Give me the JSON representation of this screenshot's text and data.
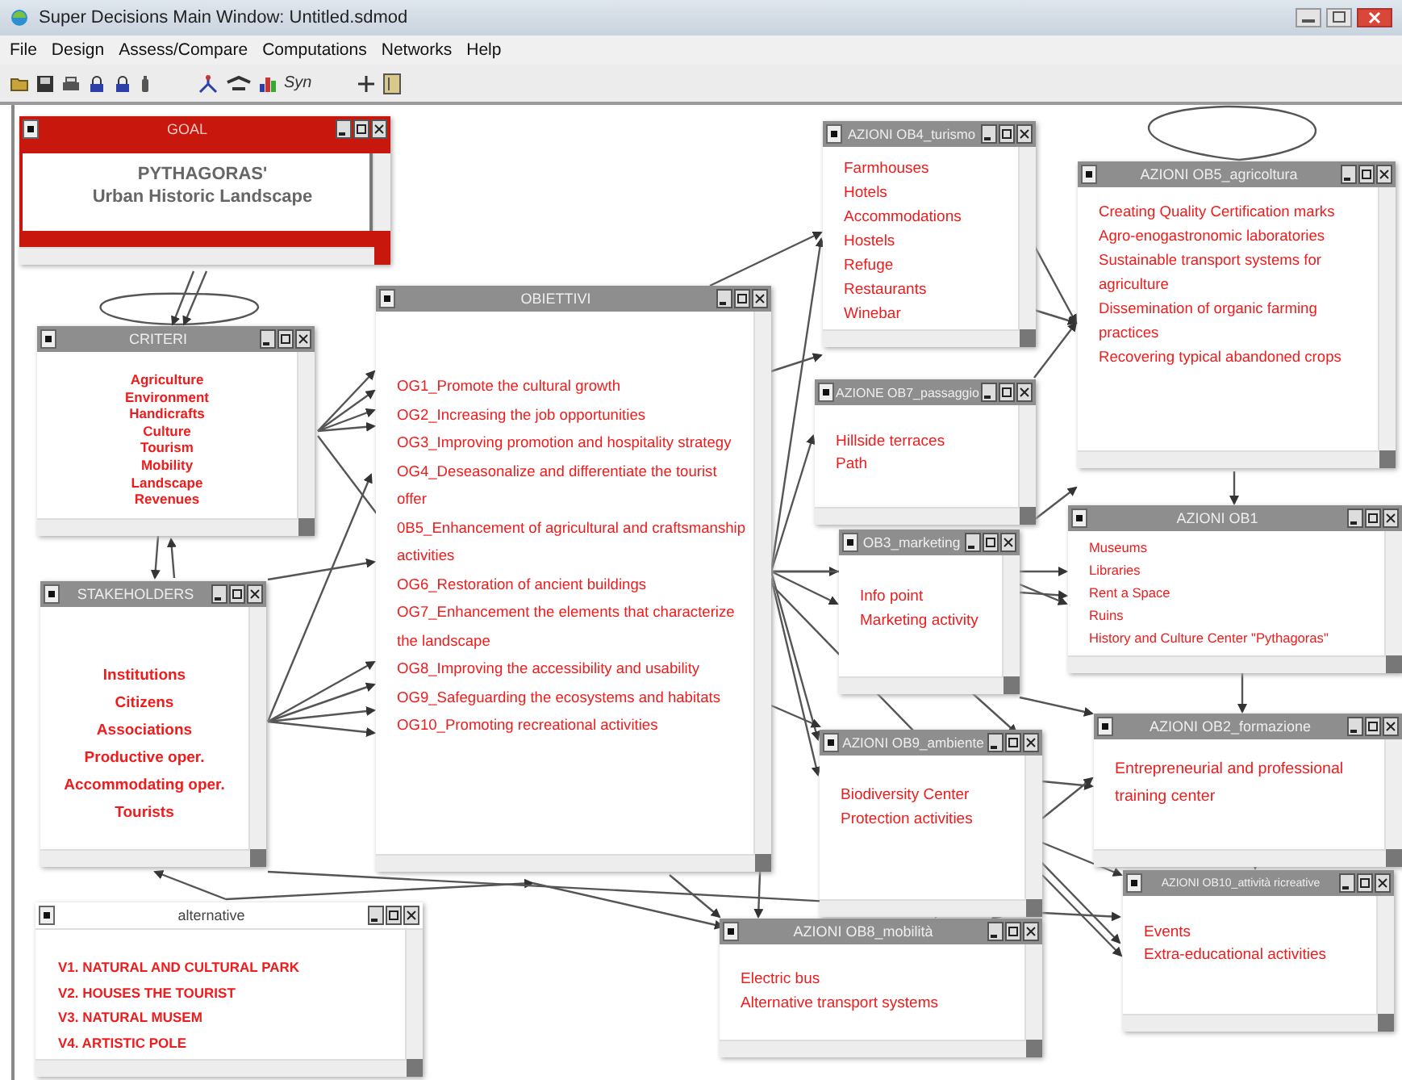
{
  "window": {
    "title": "Super Decisions Main Window: Untitled.sdmod"
  },
  "menu": [
    "File",
    "Design",
    "Assess/Compare",
    "Computations",
    "Networks",
    "Help"
  ],
  "toolbar": {
    "syn_label": "Syn"
  },
  "clusters": [
    {
      "kind": "goal",
      "title": "GOAL",
      "items": [
        "PYTHAGORAS'",
        "Urban Historic Landscape"
      ]
    },
    {
      "kind": "centered",
      "title": "CRITERI",
      "items": [
        "Agriculture",
        "Environment",
        "Handicrafts",
        "Culture",
        "Tourism",
        "Mobility",
        "Landscape",
        "Revenues"
      ]
    },
    {
      "kind": "list",
      "title": "OBIETTIVI",
      "items": [
        "OG1_Promote the cultural growth",
        "OG2_Increasing the job opportunities",
        "OG3_Improving promotion and hospitality strategy",
        "OG4_Deseasonalize and differentiate the tourist offer",
        "0B5_Enhancement of agricultural and craftsmanship activities",
        "OG6_Restoration of ancient buildings",
        "OG7_Enhancement the elements that characterize the landscape",
        "OG8_Improving the accessibility and usability",
        "OG9_Safeguarding the ecosystems and habitats",
        "OG10_Promoting recreational activities"
      ]
    },
    {
      "kind": "centered",
      "title": "STAKEHOLDERS",
      "items": [
        "Institutions",
        "Citizens",
        "Associations",
        "Productive oper.",
        "Accommodating oper.",
        "Tourists"
      ]
    },
    {
      "kind": "caps",
      "title": "alternative",
      "items": [
        "V1.  NATURAL AND CULTURAL PARK",
        "V2.  HOUSES THE TOURIST",
        "V3.  NATURAL MUSEM",
        "V4.  ARTISTIC POLE"
      ]
    },
    {
      "kind": "list",
      "title": "AZIONI OB4_turismo",
      "items": [
        "Farmhouses",
        "Hotels",
        "Accommodations",
        "Hostels",
        "Refuge",
        "Restaurants",
        "Winebar"
      ]
    },
    {
      "kind": "list",
      "title": "AZIONE OB7_passaggio",
      "items": [
        "Hillside terraces",
        "Path"
      ]
    },
    {
      "kind": "list",
      "title": "AZIONI OB5_agricoltura",
      "items": [
        "Creating Quality Certification marks",
        "Agro-enogastronomic laboratories",
        "Sustainable transport systems for agriculture",
        "Dissemination of organic farming practices",
        "Recovering typical abandoned crops"
      ]
    },
    {
      "kind": "list",
      "title": "OB3_marketing",
      "items": [
        "Info point",
        "Marketing activity"
      ]
    },
    {
      "kind": "list",
      "title": "AZIONI OB1",
      "items": [
        "Museums",
        "Libraries",
        "Rent a Space",
        "Ruins",
        "History and Culture Center \"Pythagoras\""
      ]
    },
    {
      "kind": "list",
      "title": "AZIONI OB2_formazione",
      "items": [
        "Entrepreneurial and professional training center"
      ]
    },
    {
      "kind": "list",
      "title": "AZIONI OB9_ambiente",
      "items": [
        "Biodiversity Center",
        "Protection activities"
      ]
    },
    {
      "kind": "list",
      "title": "AZIONI OB10_attività ricreative",
      "items": [
        "Events",
        "Extra-educational activities"
      ]
    },
    {
      "kind": "list",
      "title": "AZIONI OB8_mobilità",
      "items": [
        "Electric bus",
        "Alternative transport systems"
      ]
    }
  ]
}
